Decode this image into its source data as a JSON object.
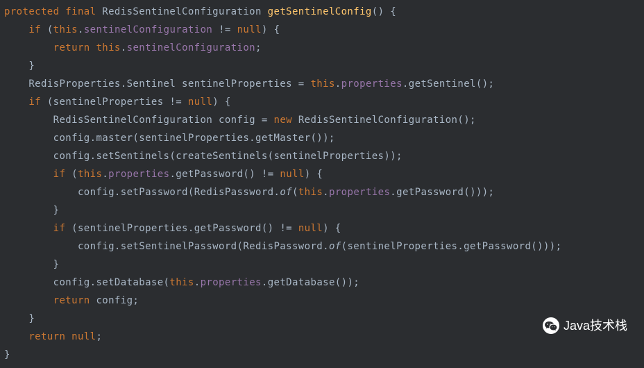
{
  "code": {
    "line1": {
      "t1": "protected final ",
      "t2": "RedisSentinelConfiguration ",
      "t3": "getSentinelConfig",
      "t4": "() {"
    },
    "line2": {
      "t1": "if ",
      "t2": "(",
      "t3": "this",
      "t4": ".",
      "t5": "sentinelConfiguration",
      "t6": " != ",
      "t7": "null",
      "t8": ") {"
    },
    "line3": {
      "t1": "return this",
      "t2": ".",
      "t3": "sentinelConfiguration",
      "t4": ";"
    },
    "line4": {
      "t1": "}"
    },
    "line5": {
      "t1": "RedisProperties.Sentinel sentinelProperties = ",
      "t2": "this",
      "t3": ".",
      "t4": "properties",
      "t5": ".getSentinel();"
    },
    "line6": {
      "t1": "if ",
      "t2": "(sentinelProperties != ",
      "t3": "null",
      "t4": ") {"
    },
    "line7": {
      "t1": "RedisSentinelConfiguration config = ",
      "t2": "new ",
      "t3": "RedisSentinelConfiguration();"
    },
    "line8": {
      "t1": "config.master(sentinelProperties.getMaster());"
    },
    "line9": {
      "t1": "config.setSentinels(createSentinels(sentinelProperties));"
    },
    "line10": {
      "t1": "if ",
      "t2": "(",
      "t3": "this",
      "t4": ".",
      "t5": "properties",
      "t6": ".getPassword() != ",
      "t7": "null",
      "t8": ") {"
    },
    "line11": {
      "t1": "config.setPassword(RedisPassword.",
      "t2": "of",
      "t3": "(",
      "t4": "this",
      "t5": ".",
      "t6": "properties",
      "t7": ".getPassword()));"
    },
    "line12": {
      "t1": "}"
    },
    "line13": {
      "t1": "if ",
      "t2": "(sentinelProperties.getPassword() != ",
      "t3": "null",
      "t4": ") {"
    },
    "line14": {
      "t1": "config.setSentinelPassword(RedisPassword.",
      "t2": "of",
      "t3": "(sentinelProperties.getPassword()));"
    },
    "line15": {
      "t1": "}"
    },
    "line16": {
      "t1": "config.setDatabase(",
      "t2": "this",
      "t3": ".",
      "t4": "properties",
      "t5": ".getDatabase());"
    },
    "line17": {
      "t1": "return ",
      "t2": "config;"
    },
    "line18": {
      "t1": "}"
    },
    "line19": {
      "t1": "return null",
      "t2": ";"
    },
    "line20": {
      "t1": "}"
    }
  },
  "watermark": {
    "text": "Java技术栈"
  }
}
